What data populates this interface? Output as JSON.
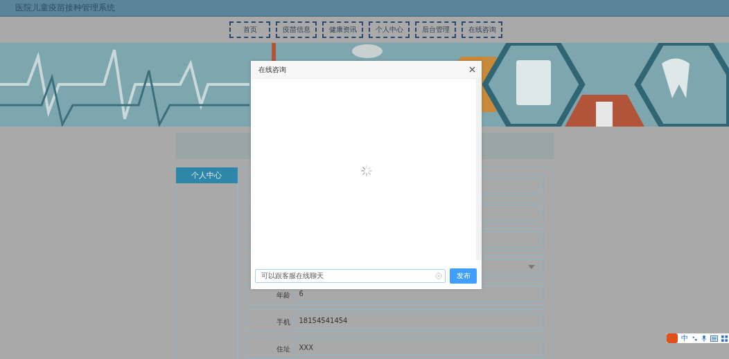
{
  "header": {
    "title": "医院儿童疫苗接种管理系统"
  },
  "nav": [
    {
      "label": "首页"
    },
    {
      "label": "疫苗信息"
    },
    {
      "label": "健康资讯"
    },
    {
      "label": "个人中心"
    },
    {
      "label": "后台管理"
    },
    {
      "label": "在线咨询"
    }
  ],
  "sidebar": {
    "items": [
      {
        "label": "个人中心",
        "selected": true
      }
    ]
  },
  "form": {
    "rows": [
      {
        "kind": "input"
      },
      {
        "kind": "input"
      },
      {
        "kind": "input"
      },
      {
        "kind": "select"
      },
      {
        "kind": "input",
        "label": "年龄",
        "value": "6"
      },
      {
        "kind": "input",
        "label": "手机",
        "value": "18154541454"
      },
      {
        "kind": "input",
        "label": "住址",
        "value": "XXX"
      }
    ]
  },
  "dialog": {
    "title": "在线咨询",
    "loading": true,
    "message": {
      "value": "可以跟客服在线聊天"
    },
    "send_button": "发布"
  },
  "ime_toolbar": {
    "mode": "中"
  }
}
